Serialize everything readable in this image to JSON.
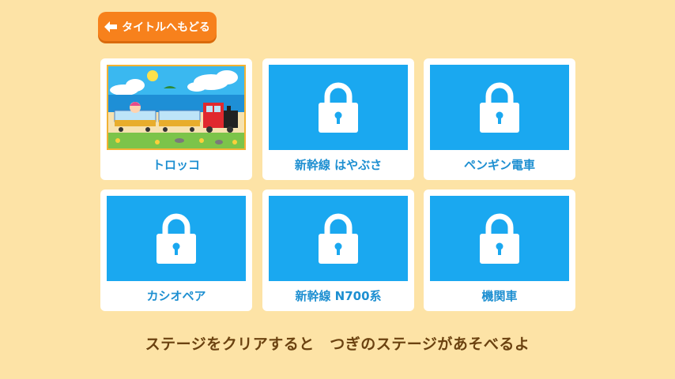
{
  "back_button": {
    "label": "タイトルへもどる",
    "icon": "arrow-left-icon"
  },
  "stages": [
    {
      "name": "トロッコ",
      "locked": false
    },
    {
      "name": "新幹線 はやぶさ",
      "locked": true
    },
    {
      "name": "ペンギン電車",
      "locked": true
    },
    {
      "name": "カシオペア",
      "locked": true
    },
    {
      "name": "新幹線 N700系",
      "locked": true
    },
    {
      "name": "機関車",
      "locked": true
    }
  ],
  "hint": "ステージをクリアすると　つぎのステージがあそべるよ",
  "colors": {
    "background": "#fde3a6",
    "button": "#f7811c",
    "locked_thumb": "#1aa8f0",
    "label": "#1d8fd1",
    "hint": "#6b4210"
  }
}
